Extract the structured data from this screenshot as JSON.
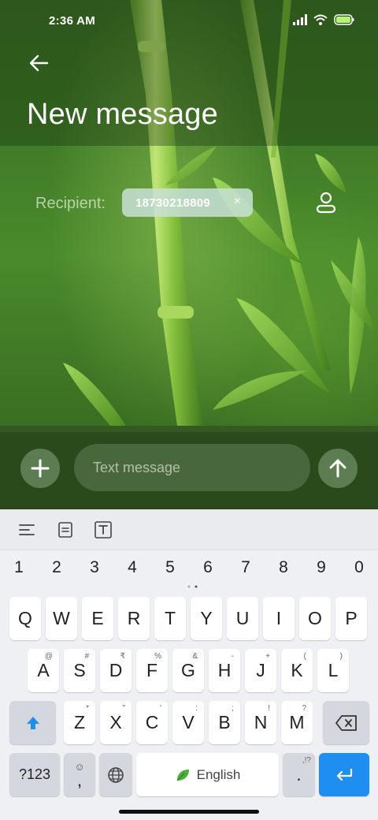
{
  "status_bar": {
    "time": "2:36 AM"
  },
  "header": {
    "title": "New message"
  },
  "recipient": {
    "label": "Recipient:",
    "chip_number": "18730218809",
    "chip_remove": "×"
  },
  "compose": {
    "placeholder": "Text message"
  },
  "keyboard": {
    "numbers": [
      "1",
      "2",
      "3",
      "4",
      "5",
      "6",
      "7",
      "8",
      "9",
      "0"
    ],
    "row1": [
      "Q",
      "W",
      "E",
      "R",
      "T",
      "Y",
      "U",
      "I",
      "O",
      "P"
    ],
    "row2": [
      {
        "key": "A",
        "sup": "@"
      },
      {
        "key": "S",
        "sup": "#"
      },
      {
        "key": "D",
        "sup": "₹"
      },
      {
        "key": "F",
        "sup": "%"
      },
      {
        "key": "G",
        "sup": "&"
      },
      {
        "key": "H",
        "sup": "-"
      },
      {
        "key": "J",
        "sup": "+"
      },
      {
        "key": "K",
        "sup": "("
      },
      {
        "key": "L",
        "sup": ")"
      }
    ],
    "row3": [
      {
        "key": "Z",
        "sup": "*"
      },
      {
        "key": "X",
        "sup": "\""
      },
      {
        "key": "C",
        "sup": "'"
      },
      {
        "key": "V",
        "sup": ":"
      },
      {
        "key": "B",
        "sup": ";"
      },
      {
        "key": "N",
        "sup": "!"
      },
      {
        "key": "M",
        "sup": "?"
      }
    ],
    "symbols_key": "?123",
    "comma_key": ",",
    "emoji_glyph": "☺",
    "space_label": "English",
    "period_key": ".",
    "period_sup": ",!?"
  },
  "colors": {
    "accent_blue": "#1f8ef1",
    "compose_bg": "#2a4a1c"
  },
  "icons": [
    "back-arrow-icon",
    "contact-icon",
    "plus-icon",
    "send-arrow-icon",
    "align-left-icon",
    "clipboard-icon",
    "text-format-icon",
    "shift-icon",
    "backspace-icon",
    "globe-icon",
    "leaf-icon",
    "enter-icon",
    "signal-icon",
    "wifi-icon",
    "battery-icon"
  ]
}
